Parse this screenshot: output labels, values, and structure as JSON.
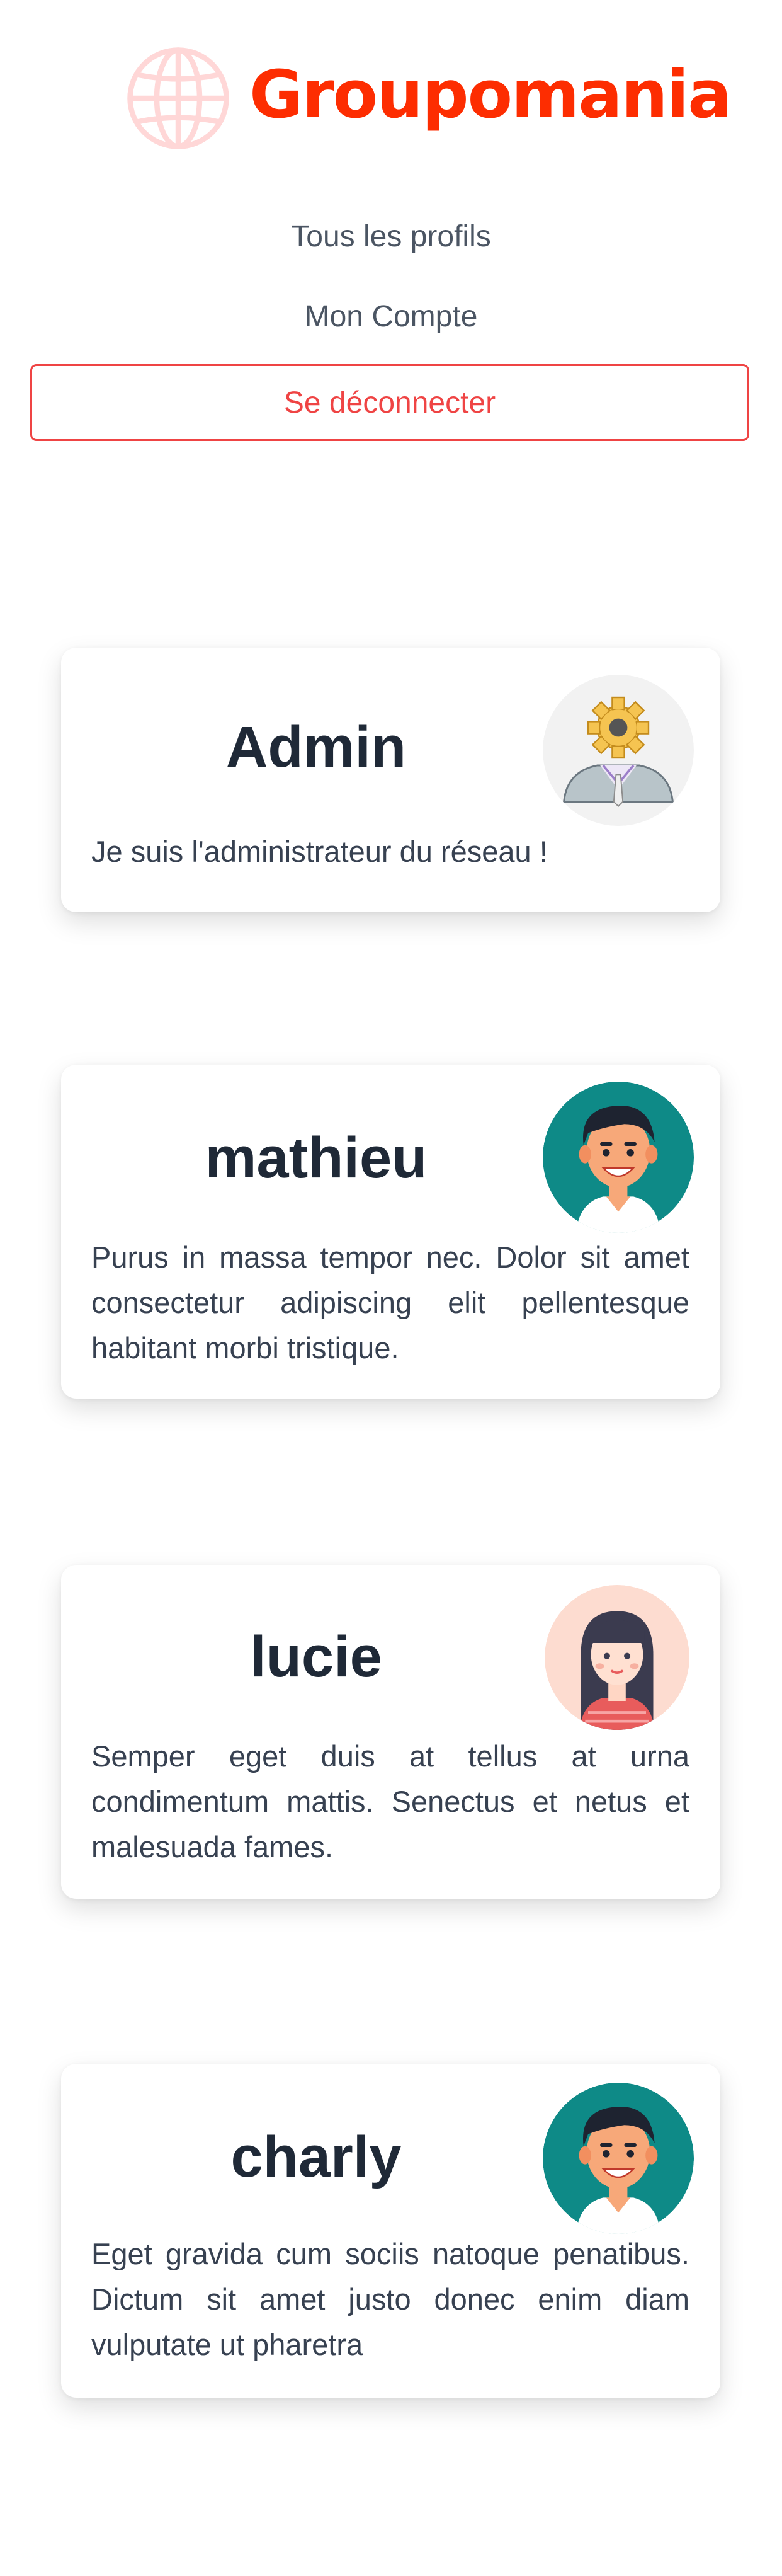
{
  "brand": {
    "name": "Groupomania",
    "color": "#fd2d01",
    "logo_icon": "globe-icon"
  },
  "nav": {
    "all_profiles": "Tous les profils",
    "my_account": "Mon Compte",
    "logout": "Se déconnecter"
  },
  "profiles": [
    {
      "name": "Admin",
      "bio": "Je suis l'administrateur du réseau !",
      "avatar": "admin-gear-avatar-icon"
    },
    {
      "name": "mathieu",
      "bio": "Purus in massa tempor nec. Dolor sit amet consectetur adipiscing elit pellentesque habitant morbi tristique.",
      "avatar": "man-avatar-icon"
    },
    {
      "name": "lucie",
      "bio": "Semper eget duis at tellus at urna condimentum mattis. Senectus et netus et malesuada fames.",
      "avatar": "woman-avatar-icon"
    },
    {
      "name": "charly",
      "bio": "Eget gravida cum sociis natoque penatibus. Dictum sit amet justo donec enim diam vulputate ut pharetra",
      "avatar": "man-avatar-icon"
    }
  ]
}
